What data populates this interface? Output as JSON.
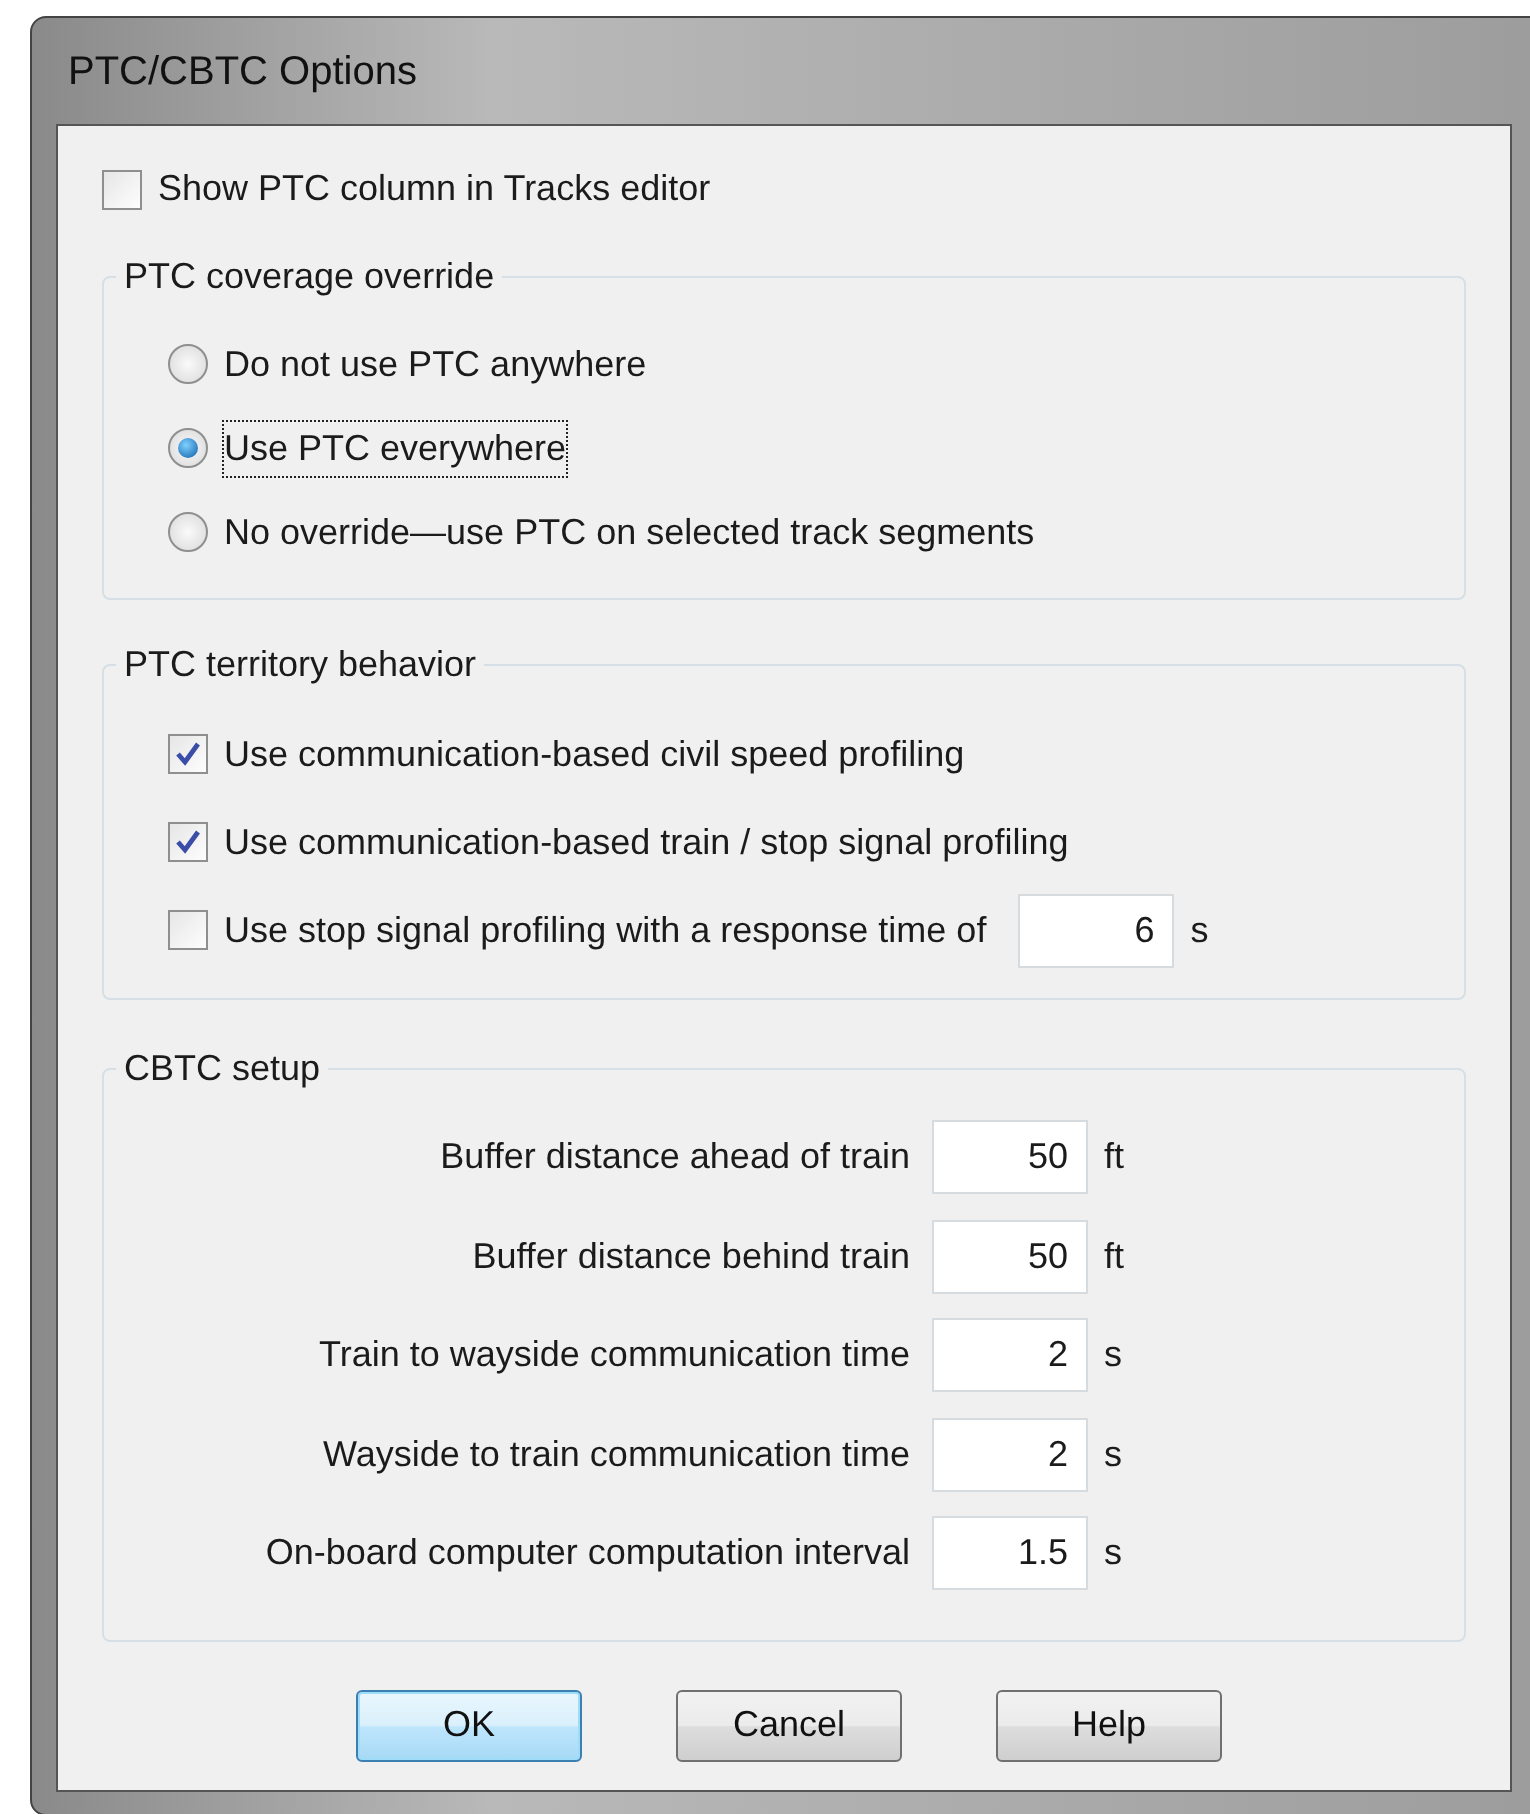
{
  "window": {
    "title": "PTC/CBTC Options"
  },
  "show_ptc_column": {
    "label": "Show PTC column in Tracks editor",
    "checked": false
  },
  "coverage_override": {
    "title": "PTC coverage override",
    "options": [
      {
        "label": "Do not use PTC anywhere",
        "selected": false,
        "focused": false
      },
      {
        "label": "Use PTC everywhere",
        "selected": true,
        "focused": true
      },
      {
        "label": "No override—use PTC on selected track segments",
        "selected": false,
        "focused": false
      }
    ]
  },
  "territory_behavior": {
    "title": "PTC territory behavior",
    "options": [
      {
        "kind": "check",
        "label": "Use communication-based civil speed profiling",
        "checked": true
      },
      {
        "kind": "check",
        "label": "Use communication-based train / stop signal profiling",
        "checked": true
      },
      {
        "kind": "check_with_value",
        "label": "Use stop signal profiling with a response time of",
        "checked": false,
        "value": "6",
        "unit": "s"
      }
    ]
  },
  "cbtc_setup": {
    "title": "CBTC setup",
    "fields": [
      {
        "label": "Buffer distance ahead of train",
        "value": "50",
        "unit": "ft"
      },
      {
        "label": "Buffer distance behind train",
        "value": "50",
        "unit": "ft"
      },
      {
        "label": "Train to wayside communication time",
        "value": "2",
        "unit": "s"
      },
      {
        "label": "Wayside to train communication time",
        "value": "2",
        "unit": "s"
      },
      {
        "label": "On-board computer computation interval",
        "value": "1.5",
        "unit": "s"
      }
    ]
  },
  "buttons": [
    {
      "label": "OK",
      "default": true
    },
    {
      "label": "Cancel",
      "default": false
    },
    {
      "label": "Help",
      "default": false
    }
  ]
}
